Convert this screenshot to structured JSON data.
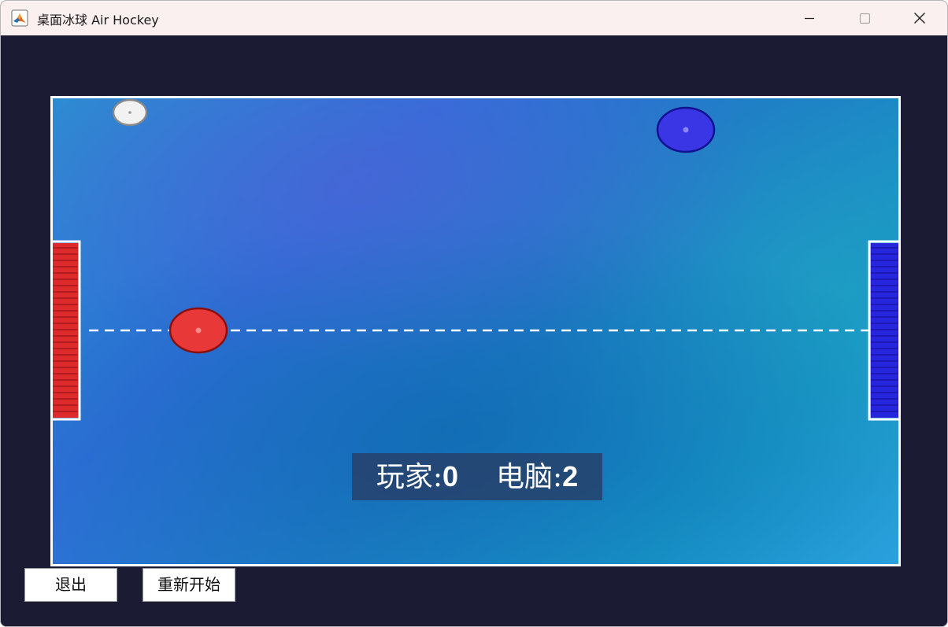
{
  "window": {
    "title": "桌面冰球 Air Hockey"
  },
  "icons": {
    "app": "matlab-icon",
    "minimize": "minimize-icon",
    "maximize": "maximize-icon",
    "close": "close-icon"
  },
  "colors": {
    "background": "#1b1b33",
    "rink_border": "#ffffff",
    "player_goal": "#dd2a2a",
    "computer_goal": "#2626dd",
    "player_mallet": "#e83838",
    "computer_mallet": "#3a36e6",
    "puck": "#f2f2f2"
  },
  "scoreboard": {
    "player_label": "玩家:",
    "player_score": "0",
    "computer_label": "电脑:",
    "computer_score": "2"
  },
  "buttons": {
    "exit": "退出",
    "restart": "重新开始"
  }
}
